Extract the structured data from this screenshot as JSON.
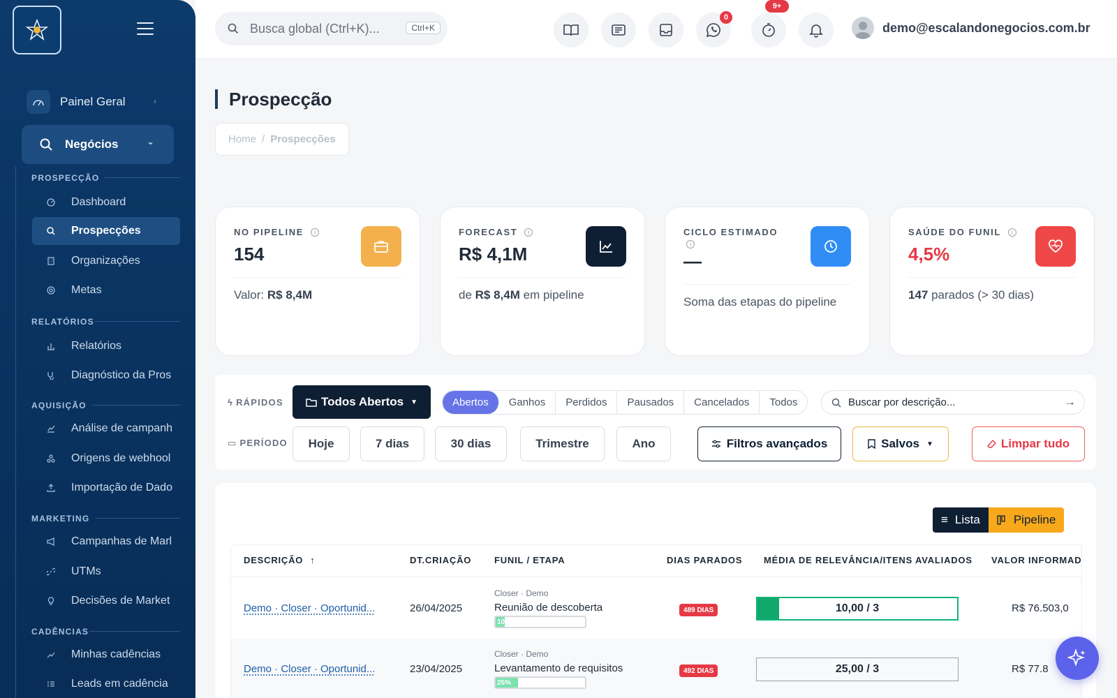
{
  "colors": {
    "sidebar": "#0a3462",
    "accent": "#6674e8",
    "danger": "#e53945",
    "success": "#10a86d"
  },
  "sidebar": {
    "top_item": {
      "label": "Painel Geral",
      "icon": "gauge-icon"
    },
    "group": {
      "label": "Negócios",
      "icon": "search-icon"
    },
    "sections": [
      {
        "title": "PROSPECÇÃO",
        "items": [
          {
            "label": "Dashboard",
            "icon": "dashboard-icon"
          },
          {
            "label": "Prospecções",
            "icon": "search-icon"
          },
          {
            "label": "Organizações",
            "icon": "building-icon"
          },
          {
            "label": "Metas",
            "icon": "target-icon"
          }
        ]
      },
      {
        "title": "RELATÓRIOS",
        "items": [
          {
            "label": "Relatórios",
            "icon": "bar-chart-icon"
          },
          {
            "label": "Diagnóstico da Pros",
            "icon": "stethoscope-icon"
          }
        ]
      },
      {
        "title": "AQUISIÇÃO",
        "items": [
          {
            "label": "Análise de campanh",
            "icon": "line-chart-icon"
          },
          {
            "label": "Origens de webhool",
            "icon": "webhook-icon"
          },
          {
            "label": "Importação de Dado",
            "icon": "upload-icon"
          }
        ]
      },
      {
        "title": "MARKETING",
        "items": [
          {
            "label": "Campanhas de Marl",
            "icon": "megaphone-icon"
          },
          {
            "label": "UTMs",
            "icon": "link-icon"
          },
          {
            "label": "Decisões de Market",
            "icon": "lightbulb-icon"
          }
        ]
      },
      {
        "title": "CADÊNCIAS",
        "items": [
          {
            "label": "Minhas cadências",
            "icon": "trend-icon"
          },
          {
            "label": "Leads em cadência",
            "icon": "list-icon"
          }
        ]
      }
    ]
  },
  "topbar": {
    "search_placeholder": "Busca global (Ctrl+K)...",
    "shortcut": "Ctrl+K",
    "buttons": [
      {
        "icon": "book-icon"
      },
      {
        "icon": "newspaper-icon"
      },
      {
        "icon": "inbox-icon"
      },
      {
        "icon": "whatsapp-icon",
        "badge": "0"
      },
      {
        "icon": "timer-icon",
        "badge": "9+"
      },
      {
        "icon": "bell-icon"
      }
    ],
    "user_email": "demo@escalandonegocios.com.br"
  },
  "page": {
    "title": "Prospecção",
    "breadcrumb": [
      "Home",
      "Prospecções"
    ]
  },
  "cards": [
    {
      "label": "NO PIPELINE",
      "value": "154",
      "sub_prefix": "Valor: ",
      "sub_bold": "R$ 8,4M",
      "sub_suffix": "",
      "icon": "briefcase-icon",
      "color": "#f3b04c"
    },
    {
      "label": "FORECAST",
      "value": "R$ 4,1M",
      "sub_prefix": "de ",
      "sub_bold": "R$ 8,4M",
      "sub_suffix": " em pipeline",
      "icon": "chart-icon",
      "color": "#0f1f33"
    },
    {
      "label": "CICLO ESTIMADO",
      "value": "—",
      "sub_prefix": "Soma das etapas do pipeline",
      "sub_bold": "",
      "sub_suffix": "",
      "icon": "clock-icon",
      "color": "#2f8df5"
    },
    {
      "label": "SAÚDE DO FUNIL",
      "value": "4,5%",
      "sub_prefix": "",
      "sub_bold": "147",
      "sub_suffix": " parados (> 30 dias)",
      "icon": "heart-pulse-icon",
      "color": "#ef4747"
    }
  ],
  "filters": {
    "rapidos_label": "RÁPIDOS",
    "periodo_label": "PERÍODO",
    "view_dropdown": "Todos Abertos",
    "status_tabs": [
      "Abertos",
      "Ganhos",
      "Perdidos",
      "Pausados",
      "Cancelados",
      "Todos"
    ],
    "active_status": "Abertos",
    "search_placeholder": "Buscar por descrição...",
    "periods": [
      "Hoje",
      "7 dias",
      "30 dias",
      "Trimestre",
      "Ano"
    ],
    "advanced": "Filtros avançados",
    "saved": "Salvos",
    "clear": "Limpar tudo"
  },
  "view_toggle": {
    "list": "Lista",
    "pipeline": "Pipeline",
    "active": "Pipeline"
  },
  "table": {
    "columns": [
      "DESCRIÇÃO",
      "DT.CRIAÇÃO",
      "FUNIL / ETAPA",
      "DIAS PARADOS",
      "MÉDIA DE RELEVÂNCIA/ITENS AVALIADOS",
      "VALOR INFORMAD"
    ],
    "rows": [
      {
        "descricao": "Demo · Closer · Oportunid...",
        "data": "26/04/2025",
        "funil": "Closer · Demo",
        "etapa": "Reunião de descoberta",
        "progress_label": "10",
        "progress": 0.1,
        "dias": "489 DIAS",
        "relevancia": "10,00 / 3",
        "relevancia_fill": 0.11,
        "valor": "R$ 76.503,0"
      },
      {
        "descricao": "Demo · Closer · Oportunid...",
        "data": "23/04/2025",
        "funil": "Closer · Demo",
        "etapa": "Levantamento de requisitos",
        "progress_label": "25%",
        "progress": 0.25,
        "dias": "492 DIAS",
        "relevancia": "25,00 / 3",
        "relevancia_fill": 0,
        "valor": "R$ 77.8"
      }
    ]
  }
}
